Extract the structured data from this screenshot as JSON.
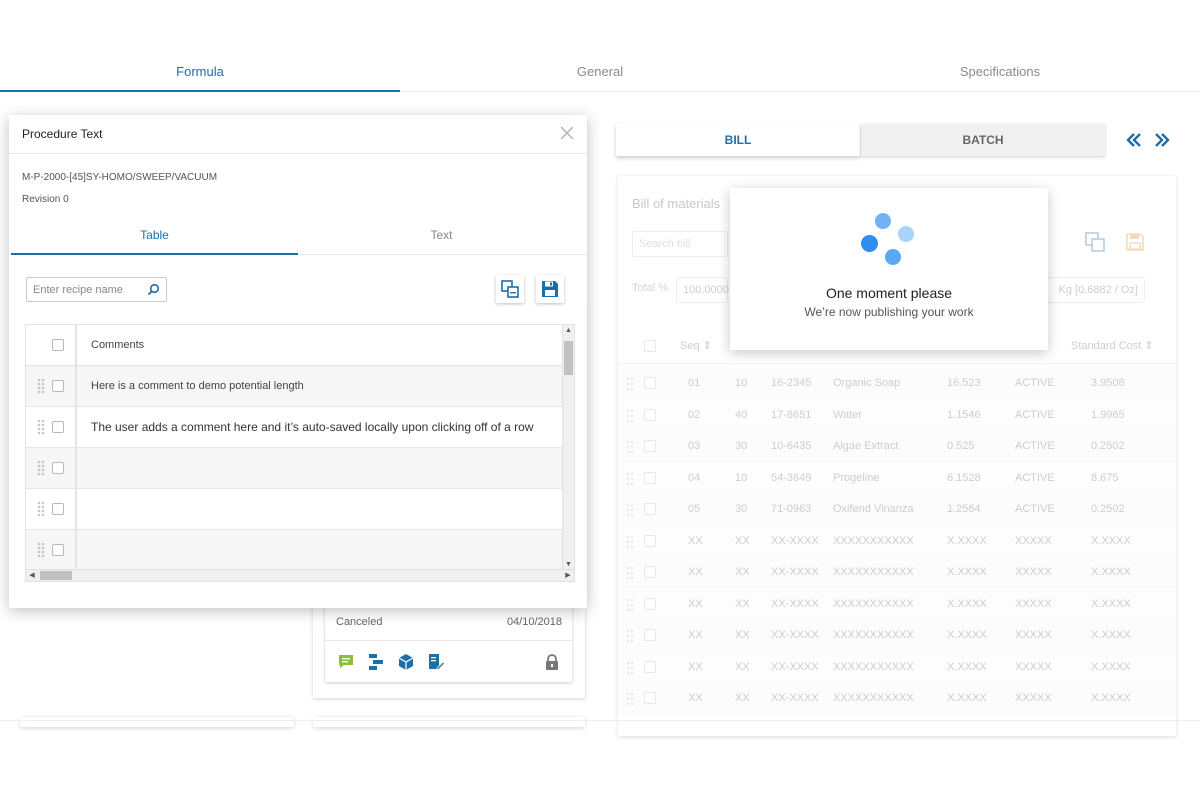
{
  "top_tabs": {
    "items": [
      {
        "label": "Formula",
        "active": true
      },
      {
        "label": "General",
        "active": false
      },
      {
        "label": "Specifications",
        "active": false
      }
    ]
  },
  "colors": {
    "accent": "#1d6fa5",
    "loader_dot_dark": "#2e8ef0",
    "loader_dot_light": "#a9d2f7",
    "comment_icon": "#8bbf3c"
  },
  "procedure_modal": {
    "title": "Procedure Text",
    "close_icon": "close-icon",
    "code": "M-P-2000-[45]SY-HOMO/SWEEP/VACUUM",
    "revision": "Revision 0",
    "tabs": [
      {
        "label": "Table",
        "active": true
      },
      {
        "label": "Text",
        "active": false
      }
    ],
    "search": {
      "placeholder": "Enter recipe name",
      "value": ""
    },
    "table": {
      "header": "Comments",
      "rows": [
        {
          "text": "Here is a comment to demo potential length"
        },
        {
          "text": "The user adds a comment here and it’s auto-saved locally upon clicking off of a row"
        },
        {
          "text": ""
        },
        {
          "text": ""
        },
        {
          "text": ""
        }
      ]
    }
  },
  "background_card": {
    "status": "Canceled",
    "date": "04/10/2018",
    "icons": [
      "comment-icon",
      "workflow-icon",
      "package-icon",
      "edit-doc-icon",
      "lock-icon"
    ]
  },
  "right_panel": {
    "segments": [
      {
        "label": "BILL",
        "active": true
      },
      {
        "label": "BATCH",
        "active": false
      }
    ],
    "bill": {
      "title": "Bill of materials",
      "search_placeholder": "Search bill",
      "total_label": "Total %",
      "total_value": "100.0000",
      "unit_value": "Kg [0.6882 / Oz]",
      "columns": [
        "Seq",
        "Standard Cost"
      ],
      "rows": [
        {
          "seq": "01",
          "n": "10",
          "code": "16-2345",
          "name": "Organic Soap",
          "pct": "16.523",
          "status": "ACTIVE",
          "cost": "3.9508"
        },
        {
          "seq": "02",
          "n": "40",
          "code": "17-8651",
          "name": "Water",
          "pct": "1.1546",
          "status": "ACTIVE",
          "cost": "1.9965"
        },
        {
          "seq": "03",
          "n": "30",
          "code": "10-6435",
          "name": "Algae Extract",
          "pct": "0.525",
          "status": "ACTIVE",
          "cost": "0.2502"
        },
        {
          "seq": "04",
          "n": "10",
          "code": "54-3649",
          "name": "Progeline",
          "pct": "6.1528",
          "status": "ACTIVE",
          "cost": "8.675"
        },
        {
          "seq": "05",
          "n": "30",
          "code": "71-0963",
          "name": "Oxifend Vinanza",
          "pct": "1.2564",
          "status": "ACTIVE",
          "cost": "0.2502"
        },
        {
          "seq": "XX",
          "n": "XX",
          "code": "XX-XXXX",
          "name": "XXXXXXXXXXX",
          "pct": "X.XXXX",
          "status": "XXXXX",
          "cost": "X.XXXX"
        },
        {
          "seq": "XX",
          "n": "XX",
          "code": "XX-XXXX",
          "name": "XXXXXXXXXXX",
          "pct": "X.XXXX",
          "status": "XXXXX",
          "cost": "X.XXXX"
        },
        {
          "seq": "XX",
          "n": "XX",
          "code": "XX-XXXX",
          "name": "XXXXXXXXXXX",
          "pct": "X.XXXX",
          "status": "XXXXX",
          "cost": "X.XXXX"
        },
        {
          "seq": "XX",
          "n": "XX",
          "code": "XX-XXXX",
          "name": "XXXXXXXXXXX",
          "pct": "X.XXXX",
          "status": "XXXXX",
          "cost": "X.XXXX"
        },
        {
          "seq": "XX",
          "n": "XX",
          "code": "XX-XXXX",
          "name": "XXXXXXXXXXX",
          "pct": "X.XXXX",
          "status": "XXXXX",
          "cost": "X.XXXX"
        },
        {
          "seq": "XX",
          "n": "XX",
          "code": "XX-XXXX",
          "name": "XXXXXXXXXXX",
          "pct": "X.XXXX",
          "status": "XXXXX",
          "cost": "X.XXXX"
        }
      ]
    }
  },
  "loader": {
    "title": "One moment please",
    "subtitle": "We’re now publishing your work"
  }
}
